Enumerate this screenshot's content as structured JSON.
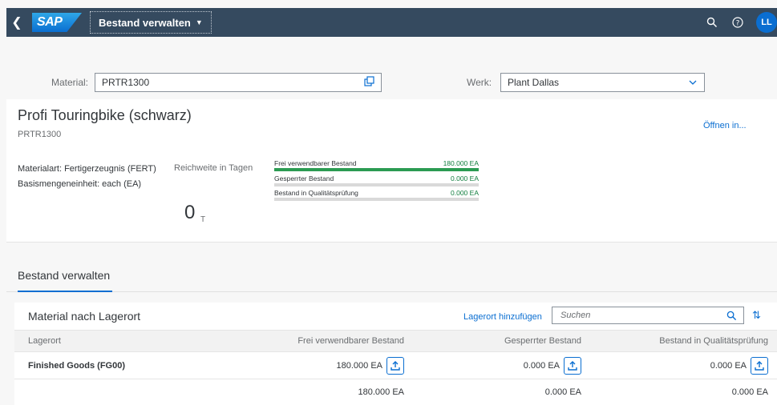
{
  "shell": {
    "logo_text": "SAP",
    "app_title": "Bestand verwalten",
    "avatar_initials": "LL"
  },
  "filter": {
    "material_label": "Material:",
    "material_value": "PRTR1300",
    "werk_label": "Werk:",
    "werk_value": "Plant Dallas"
  },
  "header": {
    "title": "Profi Touringbike (schwarz)",
    "subtitle": "PRTR1300",
    "open_in": "Öffnen in...",
    "materialart": "Materialart: Fertigerzeugnis (FERT)",
    "basismenge": "Basismengeneinheit: each (EA)",
    "reichweite_label": "Reichweite in Tagen",
    "reichweite_value": "0",
    "reichweite_unit": "T",
    "stocks": [
      {
        "label": "Frei verwendbarer Bestand",
        "value": "180.000 EA",
        "fill": 1.0
      },
      {
        "label": "Gesperrter Bestand",
        "value": "0.000 EA",
        "fill": 0.0
      },
      {
        "label": "Bestand in Qualitätsprüfung",
        "value": "0.000 EA",
        "fill": 0.0
      }
    ]
  },
  "section": {
    "tab_title": "Bestand verwalten"
  },
  "table": {
    "title": "Material nach Lagerort",
    "add_link": "Lagerort hinzufügen",
    "search_placeholder": "Suchen",
    "columns": [
      "Lagerort",
      "Frei verwendbarer Bestand",
      "Gesperrter Bestand",
      "Bestand in Qualitätsprüfung"
    ],
    "rows": [
      {
        "lagerort": "Finished Goods (FG00)",
        "frei": "180.000 EA",
        "gesperrt": "0.000 EA",
        "qualitaet": "0.000 EA"
      }
    ],
    "totals": {
      "frei": "180.000 EA",
      "gesperrt": "0.000 EA",
      "qualitaet": "0.000 EA"
    }
  },
  "colors": {
    "shell_bg": "#354a5f",
    "accent": "#0a6ed1",
    "positive": "#107e3e"
  }
}
